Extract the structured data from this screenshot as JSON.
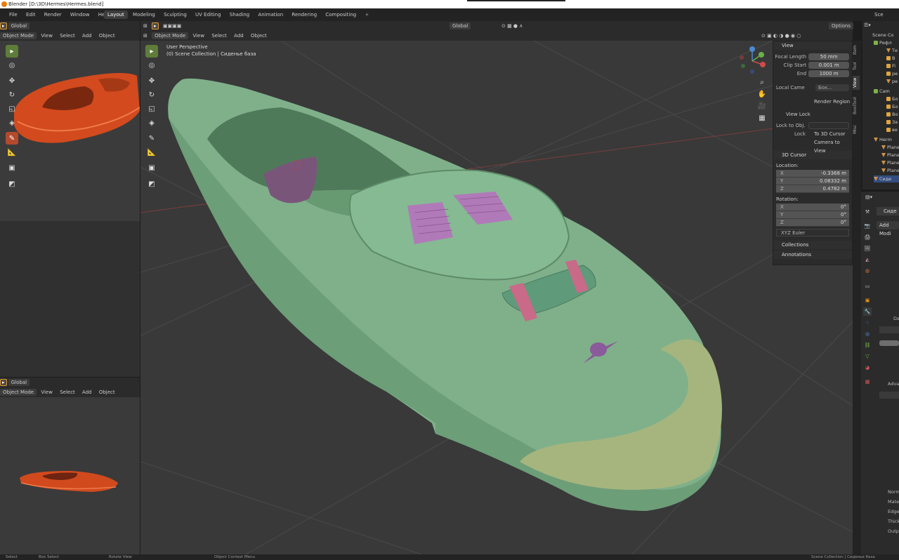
{
  "titlebar": {
    "title": "Blender [D:\\3D\\Hermes\\Hermes.blend]"
  },
  "topbar": {
    "menu": [
      "File",
      "Edit",
      "Render",
      "Window",
      "Help"
    ],
    "workspaces": [
      "Layout",
      "Modeling",
      "Sculpting",
      "UV Editing",
      "Shading",
      "Animation",
      "Rendering",
      "Compositing",
      "+"
    ],
    "right_label": "Sce"
  },
  "left_top": {
    "transform": "Global",
    "mode": "Object Mode",
    "menus": [
      "View",
      "Select",
      "Add",
      "Object"
    ]
  },
  "left_bottom": {
    "transform": "Global",
    "mode": "Object Mode",
    "menus": [
      "View",
      "Select",
      "Add",
      "Object"
    ]
  },
  "main_header": {
    "mode": "Object Mode",
    "menus": [
      "View",
      "Select",
      "Add",
      "Object"
    ],
    "transform": "Global",
    "options": "Options"
  },
  "viewport": {
    "perspective": "User Perspective",
    "collection": "(0) Scene Collection | Сиденье база"
  },
  "npanel": {
    "view": {
      "header": "View",
      "focal_length_label": "Focal Length",
      "focal_length": "50 mm",
      "clip_start_label": "Clip Start",
      "clip_start": "0.001 m",
      "end_label": "End",
      "end": "1000 m",
      "local_camera_label": "Local Came",
      "local_camera_value": "Бок...",
      "render_region": "Render Region",
      "view_lock": "View Lock",
      "lock_to_object": "Lock to Obj.",
      "lock_label": "Lock",
      "to_3d_cursor": "To 3D Cursor",
      "camera_to_view": "Camera to View"
    },
    "cursor": {
      "header": "3D Cursor",
      "location_label": "Location:",
      "x_label": "X",
      "x": "-0.3368 m",
      "y_label": "Y",
      "y": "0.08332 m",
      "z_label": "Z",
      "z": "0.4782 m",
      "rotation_label": "Rotation:",
      "rx": "0°",
      "ry": "0°",
      "rz": "0°",
      "rotation_mode": "XYZ Euler"
    },
    "collections": "Collections",
    "annotations": "Annotations",
    "tabs": [
      "Item",
      "Tool",
      "View",
      "BoolTool",
      "Misc"
    ]
  },
  "outliner": {
    "header": "Scene Co",
    "items": [
      "Рефл",
      "Те",
      "В",
      "Fi",
      "ре",
      "ре",
      "Cam",
      "Бо",
      "Бо",
      "Во",
      "За",
      "ве",
      "Herm",
      "Plane",
      "Plane",
      "Plane",
      "Plane",
      "Сиде"
    ]
  },
  "properties": {
    "object_name": "Сиде",
    "add_modifier": "Add Modi",
    "labels": [
      "Data",
      "Adva",
      "Norm",
      "Mate",
      "Edge",
      "Thick",
      "Outp"
    ]
  },
  "statusbar": {
    "items": [
      "Select",
      "Box Select",
      "Rotate View",
      "Object Context Menu",
      "Scene Collection | Сиденье база"
    ]
  }
}
